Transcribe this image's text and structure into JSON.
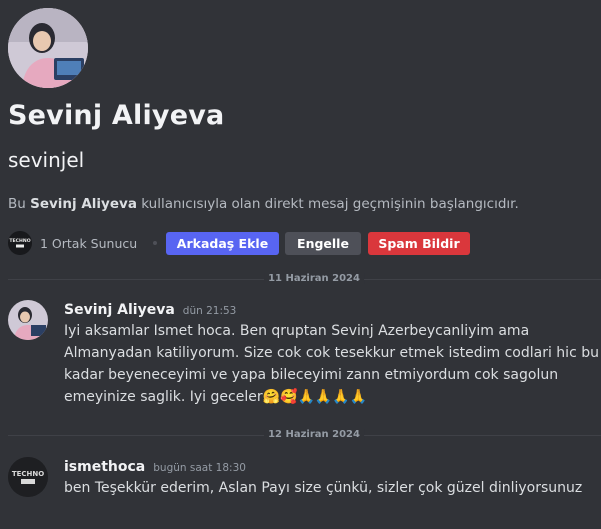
{
  "profile": {
    "display_name": "Sevinj Aliyeva",
    "username": "sevinjel",
    "intro_prefix": "Bu ",
    "intro_name": "Sevinj Aliyeva",
    "intro_suffix": " kullanıcısıyla olan direkt mesaj geçmişinin başlangıcıdır.",
    "mutual_servers": "1 Ortak Sunucu",
    "server_logo_text": "TECHNO"
  },
  "actions": {
    "add_friend": "Arkadaş Ekle",
    "block": "Engelle",
    "report_spam": "Spam Bildir"
  },
  "dividers": [
    "11 Haziran 2024",
    "12 Haziran 2024"
  ],
  "messages": [
    {
      "author": "Sevinj Aliyeva",
      "timestamp": "dün 21:53",
      "lines": [
        "Iyi aksamlar Ismet hoca. Ben qruptan Sevinj Azerbeycanliyim ama",
        "Almanyadan katiliyorum. Size cok cok tesekkur etmek istedim codlari hic bu",
        "kadar beyeneceyimi ve yapa bileceyimi zann etmiyordum cok sagolun",
        "emeyinize saglik. Iyi geceler🤗🥰🙏🙏🙏🙏"
      ]
    },
    {
      "author": "ismethoca",
      "timestamp": "bugün saat 18:30",
      "lines": [
        "ben Teşekkür ederim, Aslan Payı size çünkü, sizler çok güzel dinliyorsunuz"
      ],
      "avatar_text": "TECHNO"
    }
  ],
  "colors": {
    "background": "#313338",
    "blurple": "#5865f2",
    "danger": "#da373c",
    "secondary": "#4e5058"
  }
}
